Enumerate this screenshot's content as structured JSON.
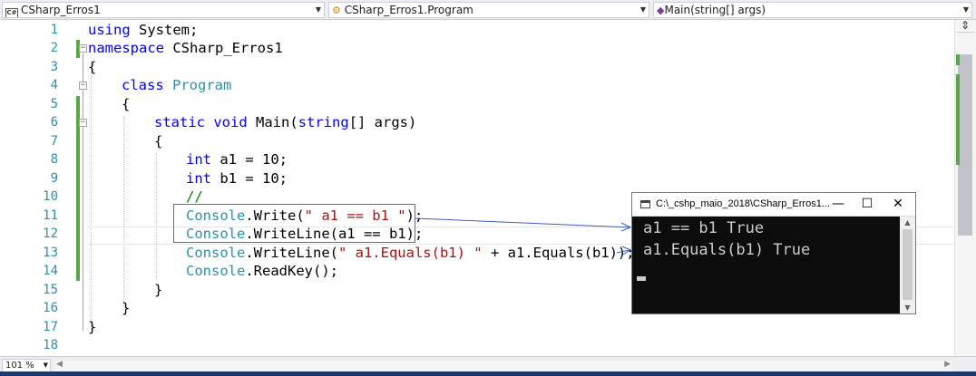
{
  "navbar": {
    "project": "CSharp_Erros1",
    "project_icon": "C#",
    "class": "CSharp_Erros1.Program",
    "member": "Main(string[] args)"
  },
  "line_numbers": [
    "1",
    "2",
    "3",
    "4",
    "5",
    "6",
    "7",
    "8",
    "9",
    "10",
    "11",
    "12",
    "13",
    "14",
    "15",
    "16",
    "17",
    "18"
  ],
  "code": {
    "l1": {
      "kw": "using",
      "rest": " System;"
    },
    "l2": {
      "kw": "namespace",
      "rest": " CSharp_Erros1"
    },
    "l3": {
      "text": "{"
    },
    "l4": {
      "kw": "class",
      "type": "Program"
    },
    "l5": {
      "text": "{"
    },
    "l6": {
      "kw1": "static",
      "kw2": "void",
      "name": "Main(",
      "kw3": "string",
      "rest": "[] args)"
    },
    "l7": {
      "text": "{"
    },
    "l8": {
      "kw": "int",
      "rest": " a1 = 10;"
    },
    "l9": {
      "kw": "int",
      "rest": " b1 = 10;"
    },
    "l10": {
      "comment": "//"
    },
    "l11": {
      "type": "Console",
      "call": ".Write(",
      "str": "\" a1 == b1 \"",
      "end": ");"
    },
    "l12": {
      "type": "Console",
      "call": ".WriteLine(a1 == b1);"
    },
    "l13": {
      "type": "Console",
      "call": ".WriteLine(",
      "str": "\" a1.Equals(b1) \"",
      "end": " + a1.Equals(b1));"
    },
    "l14": {
      "type": "Console",
      "call": ".ReadKey();"
    },
    "l15": {
      "text": "}"
    },
    "l16": {
      "text": "}"
    },
    "l17": {
      "text": "}"
    }
  },
  "console": {
    "title": "C:\\_cshp_maio_2018\\CSharp_Erros1...",
    "minimize": "—",
    "maximize": "☐",
    "close": "✕",
    "output": [
      "a1 == b1 True",
      "a1.Equals(b1) True"
    ]
  },
  "status": {
    "zoom": "101 %"
  },
  "colors": {
    "keyword": "#0000ff",
    "type": "#2b91af",
    "string": "#a31515",
    "comment": "#008000",
    "change_bar": "#57a64a"
  }
}
